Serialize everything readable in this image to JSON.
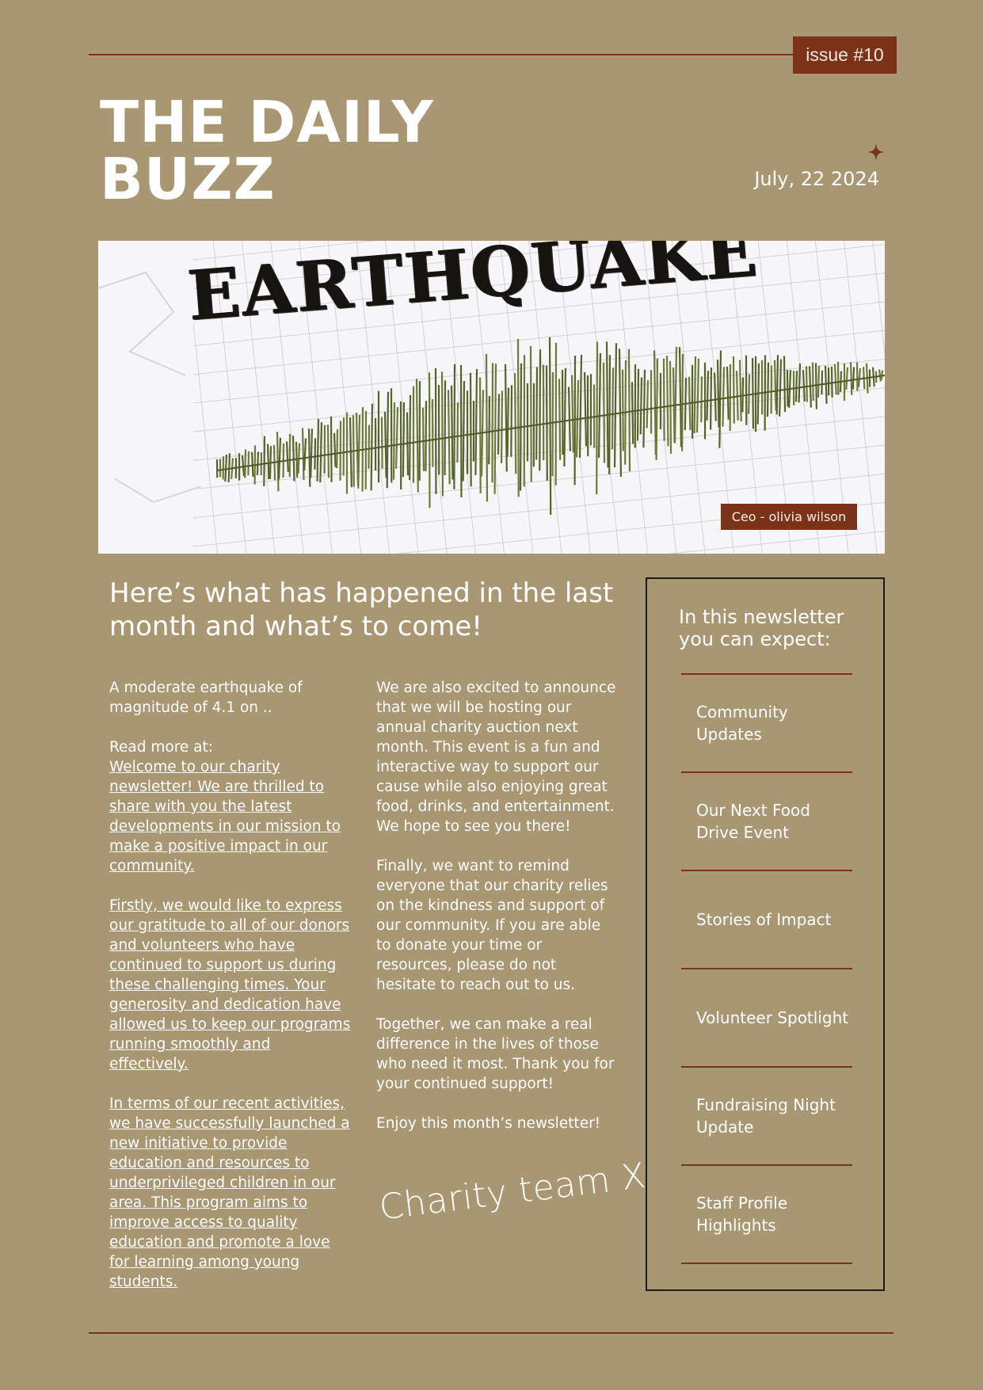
{
  "header": {
    "issue_label": "issue #10",
    "title_line1": "THE DAILY",
    "title_line2": "BUZZ",
    "date": "July, 22 2024"
  },
  "hero": {
    "image_text": "EARTHQUAKE",
    "caption": "Ceo - olivia wilson"
  },
  "article": {
    "headline": "Here’s what has happened in the last month and what’s to come!",
    "left_column": {
      "intro": "A moderate earthquake of magnitude of 4.1 on ..",
      "read_more_label": "Read more at:",
      "link_paragraph_1": "Welcome to our charity newsletter! We are thrilled to share with you the latest developments in our mission to make a positive impact in our community.",
      "link_paragraph_2": "Firstly, we would like to express our gratitude to all of our donors and volunteers who have continued to support us during these challenging times. Your generosity and dedication have allowed us to keep our programs running smoothly and effectively.",
      "link_paragraph_3": "In terms of our recent activities, we have successfully launched a new initiative to provide education and resources to underprivileged children in our area. This program aims to improve access to quality education and promote a love for learning among young students."
    },
    "right_column": {
      "paragraph_1": "We are also excited to announce that we will be hosting our annual charity auction next month. This event is a fun and interactive way to support our cause while also enjoying great food, drinks, and entertainment. We hope to see you there!",
      "paragraph_2": "Finally, we want to remind everyone that our charity relies on the kindness and support of our community. If you are able to donate your time or resources, please do not hesitate to reach out to us.",
      "paragraph_3": "Together, we can make a real difference in the lives of those who need it most. Thank you for your continued support!",
      "paragraph_4": "Enjoy this month’s newsletter!"
    },
    "signature": "Charity team X"
  },
  "sidebar": {
    "title": "In this newsletter you can expect:",
    "items": [
      {
        "label": "Community Updates"
      },
      {
        "label": "Our Next Food Drive Event"
      },
      {
        "label": "Stories of Impact"
      },
      {
        "label": "Volunteer Spotlight"
      },
      {
        "label": "Fundraising Night Update"
      },
      {
        "label": "Staff Profile Highlights"
      }
    ]
  },
  "colors": {
    "background": "#a99672",
    "accent": "#7a3318",
    "text": "#ffffff",
    "seismograph": "#6b7b3a"
  },
  "icons": {
    "star": "four-point-star-icon"
  }
}
